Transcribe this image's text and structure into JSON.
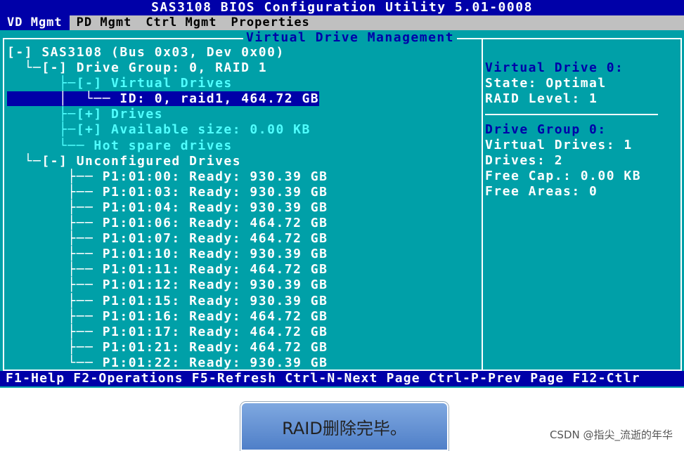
{
  "window": {
    "title": "SAS3108 BIOS Configuration Utility 5.01-0008"
  },
  "menu": [
    "VD Mgmt",
    "PD Mgmt",
    "Ctrl Mgmt",
    "Properties"
  ],
  "panel_title": "Virtual Drive Management",
  "tree": [
    "[-] SAS3108 (Bus 0x03, Dev 0x00)",
    "  └─[-] Drive Group: 0, RAID 1",
    "      ├─[-] Virtual Drives",
    "      │  └── ID: 0, raid1, 464.72 GB",
    "      ├─[+] Drives",
    "      ├─[+] Available size: 0.00 KB",
    "      └── Hot spare drives",
    "  └─[-] Unconfigured Drives",
    "       ├── P1:01:00: Ready: 930.39 GB",
    "       ├── P1:01:03: Ready: 930.39 GB",
    "       ├── P1:01:04: Ready: 930.39 GB",
    "       ├── P1:01:06: Ready: 464.72 GB",
    "       ├── P1:01:07: Ready: 464.72 GB",
    "       ├── P1:01:10: Ready: 930.39 GB",
    "       ├── P1:01:11: Ready: 464.72 GB",
    "       ├── P1:01:12: Ready: 930.39 GB",
    "       ├── P1:01:15: Ready: 930.39 GB",
    "       ├── P1:01:16: Ready: 464.72 GB",
    "       ├── P1:01:17: Ready: 464.72 GB",
    "       ├── P1:01:21: Ready: 464.72 GB",
    "       └── P1:01:22: Ready: 930.39 GB"
  ],
  "info": {
    "vd_heading": "Virtual Drive 0:",
    "vd_state": "State: Optimal",
    "vd_raid": "RAID Level: 1",
    "dg_heading": "Drive Group 0:",
    "dg_vds": "Virtual Drives: 1",
    "dg_drives": "Drives: 2",
    "dg_freecap": "Free Cap.: 0.00 KB",
    "dg_freeareas": "Free Areas: 0"
  },
  "status": "F1-Help F2-Operations F5-Refresh Ctrl-N-Next Page Ctrl-P-Prev Page F12-Ctlr",
  "caption": "RAID删除完毕。",
  "watermark": "CSDN @指尖_流逝的年华"
}
